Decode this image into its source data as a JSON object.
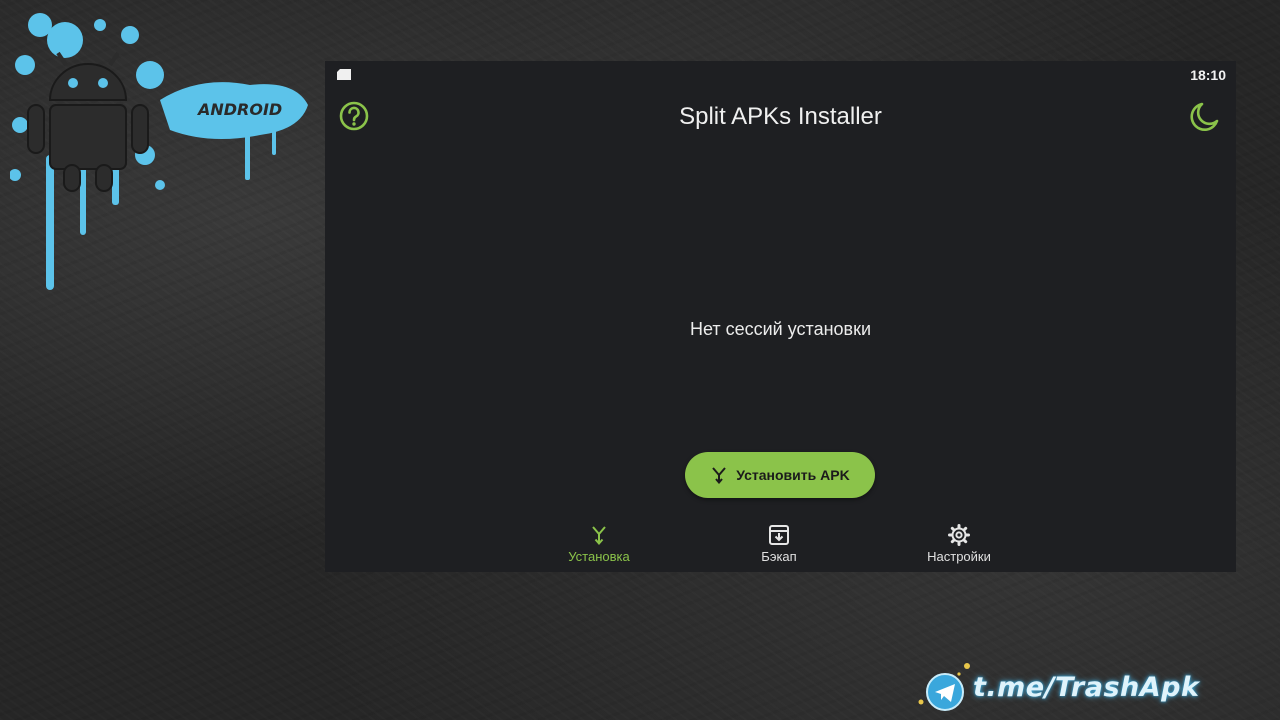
{
  "status_bar": {
    "time": "18:10",
    "sd_icon": "sd-card-icon"
  },
  "app_bar": {
    "title": "Split APKs Installer",
    "help_icon": "help-circle-icon",
    "theme_icon": "moon-icon"
  },
  "main": {
    "empty_message": "Нет сессий установки"
  },
  "install_button": {
    "label": "Установить APK",
    "icon": "split-arrow-icon"
  },
  "bottom_nav": {
    "items": [
      {
        "label": "Установка",
        "icon": "split-arrow-icon",
        "active": true
      },
      {
        "label": "Бэкап",
        "icon": "archive-icon",
        "active": false
      },
      {
        "label": "Настройки",
        "icon": "gear-icon",
        "active": false
      }
    ]
  },
  "decoration": {
    "logo_text": "ANDROID",
    "watermark": "t.me/TrashApk"
  },
  "colors": {
    "accent": "#8bc34a",
    "screen_bg": "#1e1f22",
    "splash": "#5cc3ea"
  }
}
